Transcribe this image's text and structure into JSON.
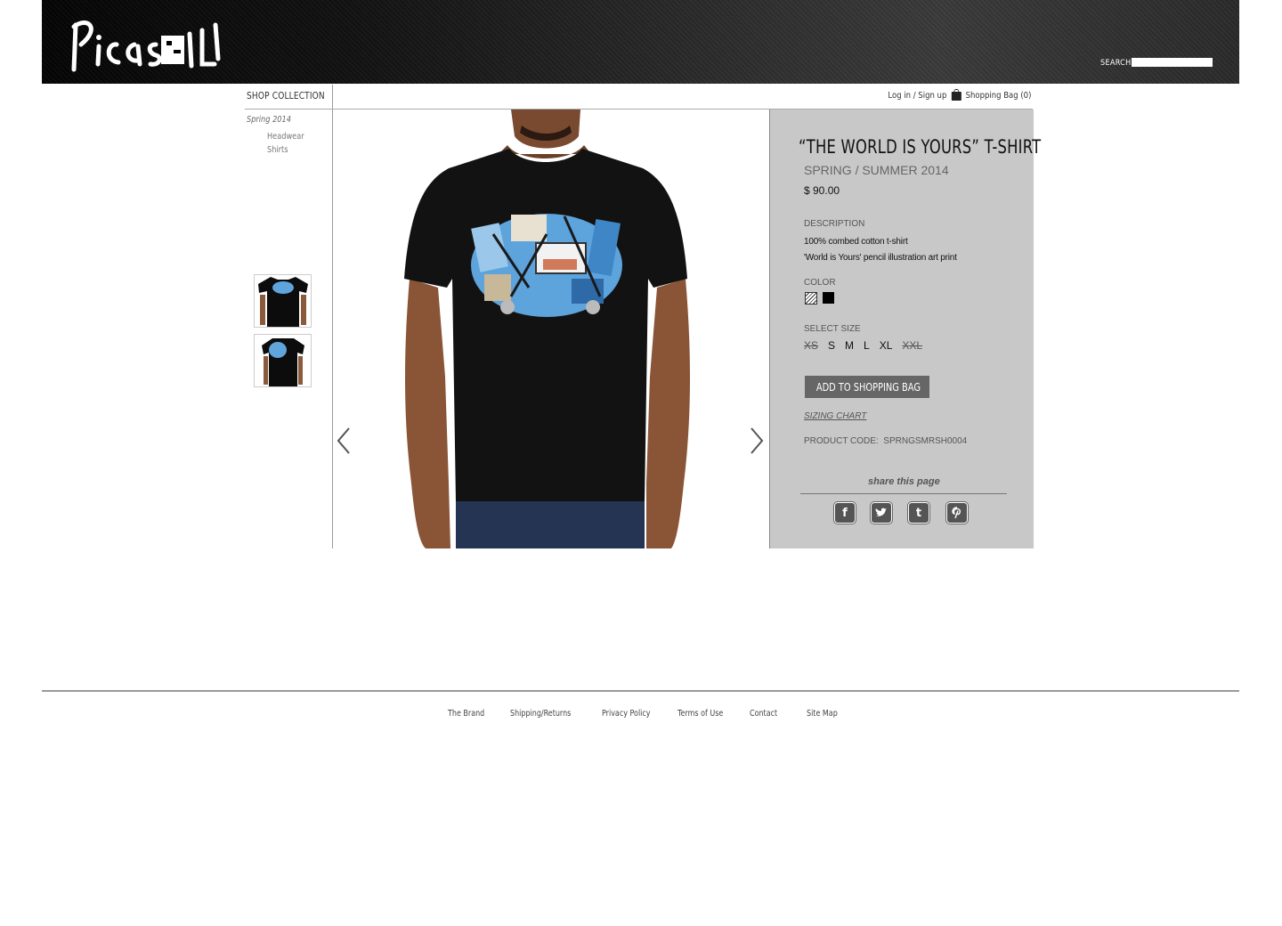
{
  "header": {
    "logo_text": "PicasSoul",
    "search_label": "SEARCH",
    "search_value": ""
  },
  "sidebar": {
    "title": "SHOP COLLECTION",
    "season": "Spring 2014",
    "items": [
      "Headwear",
      "Shirts"
    ]
  },
  "account": {
    "login": "Log in / Sign up",
    "bag": "Shopping Bag (0)"
  },
  "product": {
    "title": "“THE WORLD IS YOURS” T-SHIRT",
    "season": "SPRING / SUMMER 2014",
    "price": "$ 90.00",
    "description_label": "DESCRIPTION",
    "description": [
      "100% combed cotton t-shirt",
      "'World is Yours' pencil illustration art print"
    ],
    "color_label": "COLOR",
    "colors": [
      "#8a8a8a",
      "#000000"
    ],
    "size_label": "SELECT SIZE",
    "sizes": [
      {
        "label": "XS",
        "available": false
      },
      {
        "label": "S",
        "available": true
      },
      {
        "label": "M",
        "available": true
      },
      {
        "label": "L",
        "available": true
      },
      {
        "label": "XL",
        "available": true
      },
      {
        "label": "XXL",
        "available": false
      }
    ],
    "add_button": "ADD TO SHOPPING BAG",
    "sizing_chart": "SIZING CHART",
    "code_label": "PRODUCT CODE:",
    "code": "SPRNGSMRSH0004",
    "share_label": "share this page",
    "social": [
      "facebook-icon",
      "twitter-icon",
      "tumblr-icon",
      "pinterest-icon"
    ]
  },
  "footer": {
    "links": [
      "The Brand",
      "Shipping/Returns",
      "Privacy Policy",
      "Terms of Use",
      "Contact",
      "Site Map"
    ]
  },
  "colors": {
    "panel": "#c8c8c8",
    "button": "#666666",
    "header": "#111111"
  }
}
